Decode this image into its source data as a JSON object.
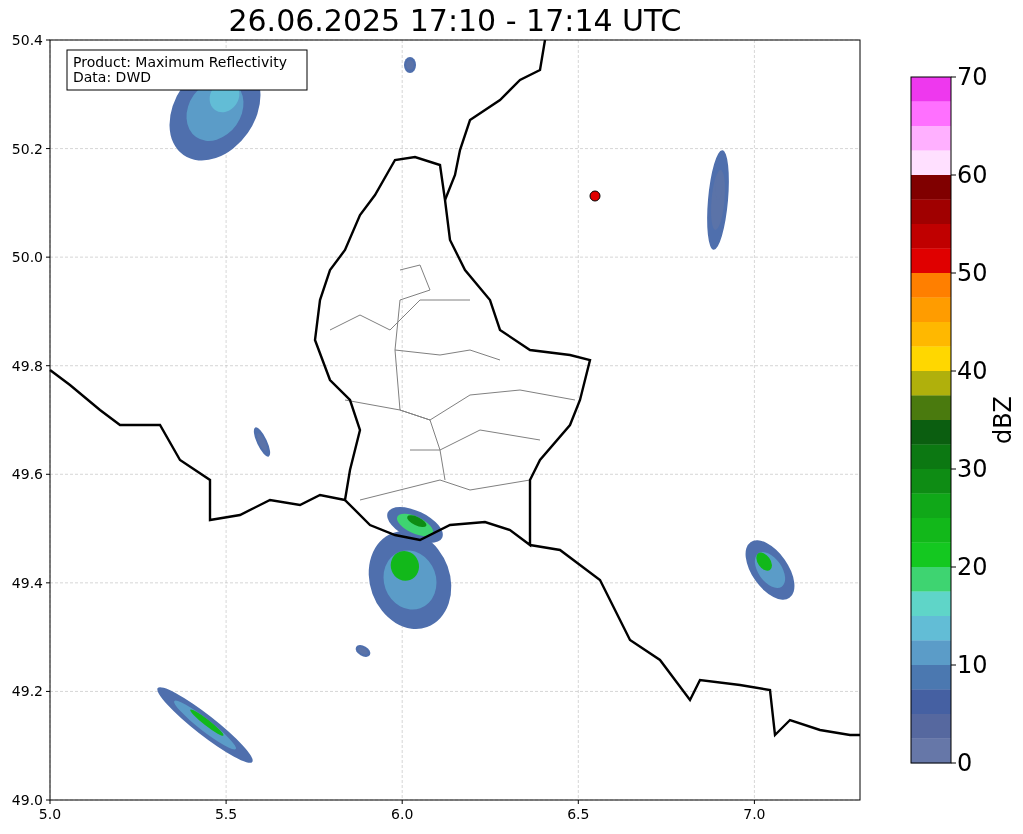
{
  "title": "26.06.2025 17:10 - 17:14 UTC",
  "info_box": [
    "Product: Maximum Reflectivity",
    "Data: DWD"
  ],
  "x_ticks": [
    "5.0",
    "5.5",
    "6.0",
    "6.5",
    "7.0"
  ],
  "y_ticks": [
    "50.4",
    "50.2",
    "50.0",
    "49.8",
    "49.6",
    "49.4",
    "49.2",
    "49.0"
  ],
  "colorbar": {
    "label": "dBZ",
    "ticks": [
      "70",
      "60",
      "50",
      "40",
      "30",
      "20",
      "10",
      "0"
    ],
    "bands": [
      {
        "color": "#ee38ee"
      },
      {
        "color": "#ff70ff"
      },
      {
        "color": "#ffb0ff"
      },
      {
        "color": "#ffe0ff"
      },
      {
        "color": "#800000"
      },
      {
        "color": "#a00000"
      },
      {
        "color": "#c00000"
      },
      {
        "color": "#e00000"
      },
      {
        "color": "#ff7f00"
      },
      {
        "color": "#ff9c00"
      },
      {
        "color": "#ffb800"
      },
      {
        "color": "#ffd700"
      },
      {
        "color": "#b0b00c"
      },
      {
        "color": "#4a7a0e"
      },
      {
        "color": "#0b5e10"
      },
      {
        "color": "#0c7812"
      },
      {
        "color": "#0e8c14"
      },
      {
        "color": "#10a818"
      },
      {
        "color": "#12b81a"
      },
      {
        "color": "#14c820"
      },
      {
        "color": "#3ed471"
      },
      {
        "color": "#5fd5c8"
      },
      {
        "color": "#62bdd6"
      },
      {
        "color": "#5b9cc8"
      },
      {
        "color": "#4b78b0"
      },
      {
        "color": "#4560a2"
      },
      {
        "color": "#56689f"
      },
      {
        "color": "#6677a8"
      }
    ]
  }
}
